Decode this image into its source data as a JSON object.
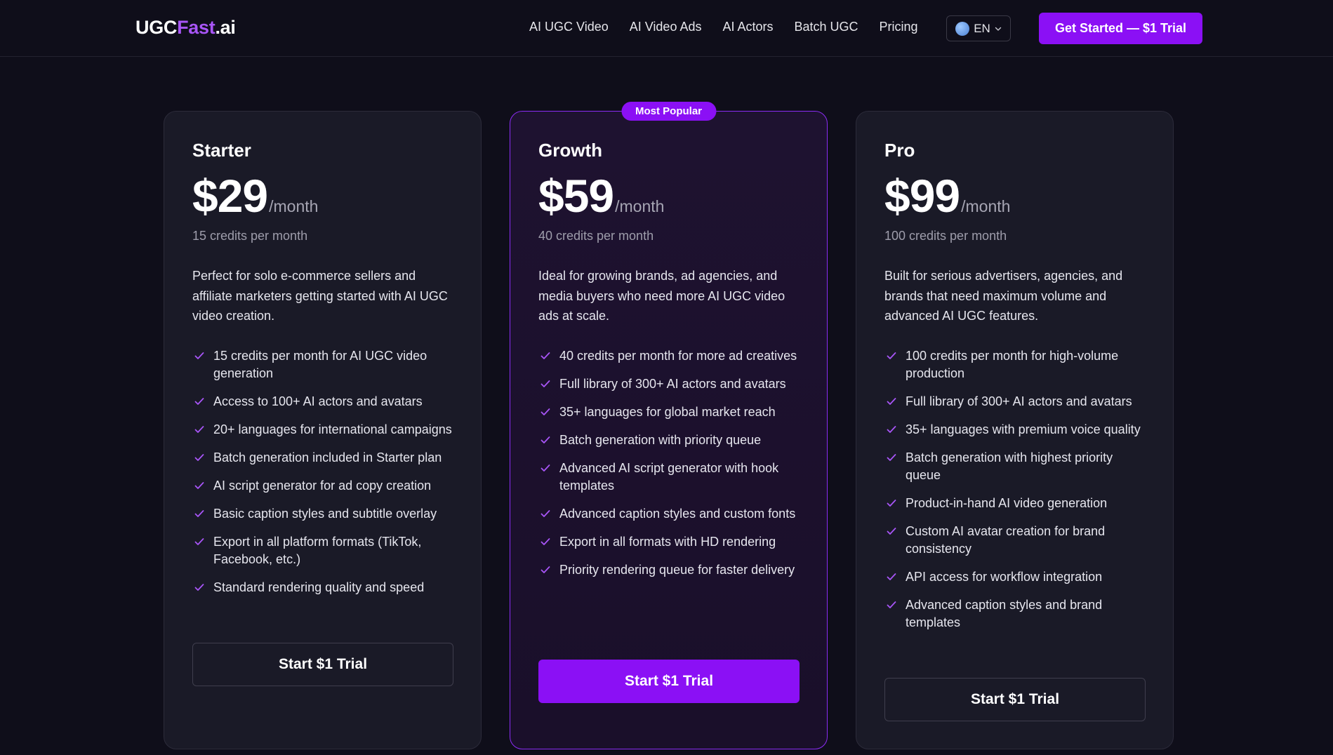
{
  "header": {
    "logo": {
      "part1": "UGC",
      "part2": "Fast",
      "part3": ".ai"
    },
    "nav": [
      "AI UGC Video",
      "AI Video Ads",
      "AI Actors",
      "Batch UGC",
      "Pricing"
    ],
    "lang_label": "EN",
    "cta_label": "Get Started — $1 Trial"
  },
  "colors": {
    "accent": "#8b10f5",
    "accent_text": "#a855f7",
    "background": "#0f0e1a"
  },
  "plans": [
    {
      "name": "Starter",
      "price": "$29",
      "period": "/month",
      "credits": "15 credits per month",
      "description": "Perfect for solo e-commerce sellers and affiliate marketers getting started with AI UGC video creation.",
      "features": [
        "15 credits per month for AI UGC video generation",
        "Access to 100+ AI actors and avatars",
        "20+ languages for international campaigns",
        "Batch generation included in Starter plan",
        "AI script generator for ad copy creation",
        "Basic caption styles and subtitle overlay",
        "Export in all platform formats (TikTok, Facebook, etc.)",
        "Standard rendering quality and speed"
      ],
      "button": "Start $1 Trial"
    },
    {
      "name": "Growth",
      "badge": "Most Popular",
      "price": "$59",
      "period": "/month",
      "credits": "40 credits per month",
      "description": "Ideal for growing brands, ad agencies, and media buyers who need more AI UGC video ads at scale.",
      "features": [
        "40 credits per month for more ad creatives",
        "Full library of 300+ AI actors and avatars",
        "35+ languages for global market reach",
        "Batch generation with priority queue",
        "Advanced AI script generator with hook templates",
        "Advanced caption styles and custom fonts",
        "Export in all formats with HD rendering",
        "Priority rendering queue for faster delivery"
      ],
      "button": "Start $1 Trial"
    },
    {
      "name": "Pro",
      "price": "$99",
      "period": "/month",
      "credits": "100 credits per month",
      "description": "Built for serious advertisers, agencies, and brands that need maximum volume and advanced AI UGC features.",
      "features": [
        "100 credits per month for high-volume production",
        "Full library of 300+ AI actors and avatars",
        "35+ languages with premium voice quality",
        "Batch generation with highest priority queue",
        "Product-in-hand AI video generation",
        "Custom AI avatar creation for brand consistency",
        "API access for workflow integration",
        "Advanced caption styles and brand templates"
      ],
      "button": "Start $1 Trial"
    }
  ]
}
